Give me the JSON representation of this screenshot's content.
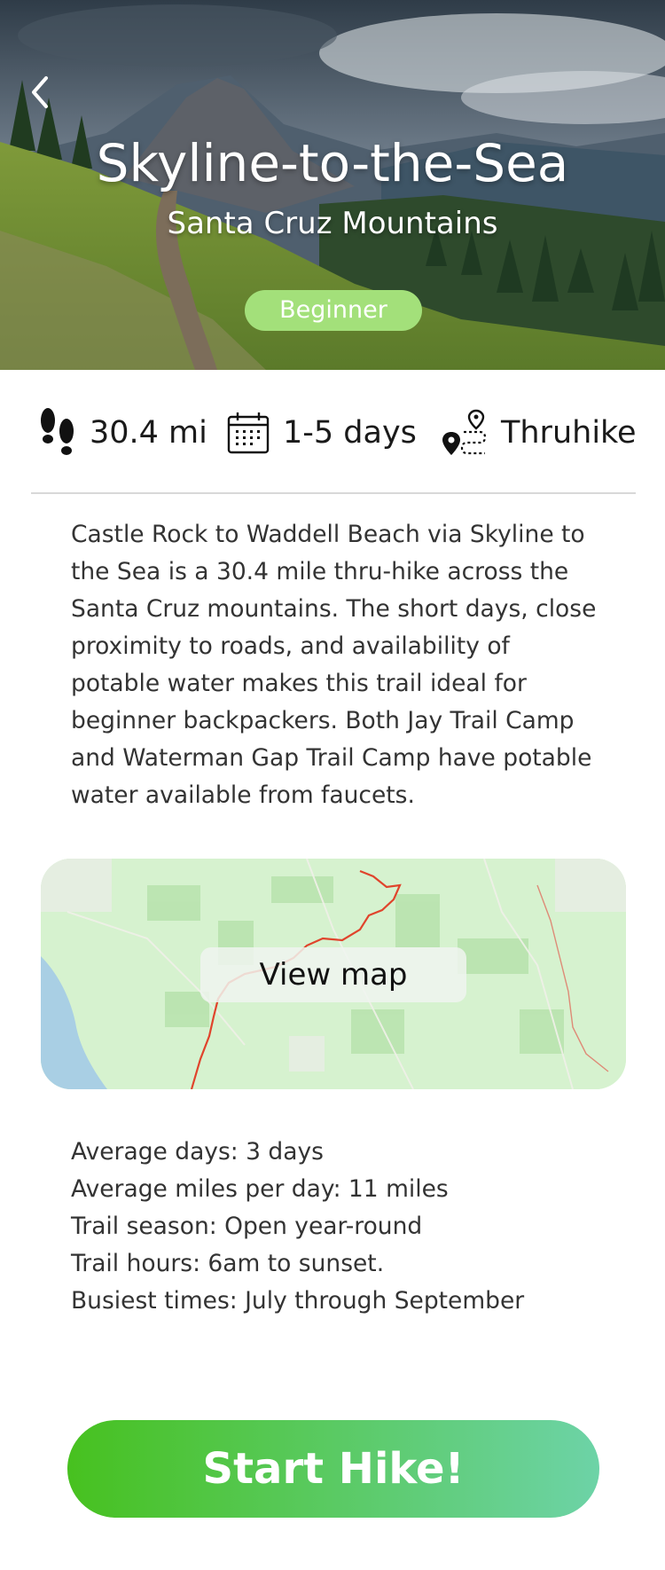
{
  "hero": {
    "back_icon": "chevron-left-icon",
    "title": "Skyline-to-the-Sea",
    "subtitle": "Santa Cruz Mountains",
    "level": "Beginner",
    "level_color": "#a3e07a"
  },
  "stats": {
    "distance": {
      "icon": "footprints-icon",
      "label": "30.4 mi"
    },
    "days": {
      "icon": "calendar-icon",
      "label": "1-5 days"
    },
    "type": {
      "icon": "route-pin-icon",
      "label": "Thruhike"
    }
  },
  "description": "Castle Rock to Waddell Beach via Skyline to the Sea is a 30.4 mile thru-hike across the Santa Cruz mountains. The short days, close proximity to roads, and availability of potable water makes this trail ideal for beginner backpackers. Both Jay Trail Camp and Waterman Gap Trail Camp have potable water available from faucets.",
  "map": {
    "button_label": "View map",
    "route_color": "#e0442c"
  },
  "details": [
    "Average days: 3 days",
    "Average miles per day: 11 miles",
    "Trail season: Open year-round",
    "Trail hours: 6am to sunset.",
    "Busiest times: July through September"
  ],
  "start_button": {
    "label": "Start Hike!",
    "gradient_start": "#47c11f",
    "gradient_end": "#6dd3a7"
  }
}
